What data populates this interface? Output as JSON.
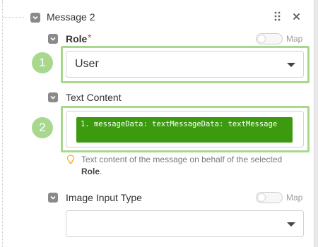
{
  "section": {
    "title": "Message 2"
  },
  "role": {
    "label": "Role",
    "required_mark": "*",
    "map_label": "Map",
    "selected_value": "User",
    "badge": "1"
  },
  "text_content": {
    "label": "Text Content",
    "badge": "2",
    "pill_text": "1. messageData: textMessageData: textMessage",
    "hint_prefix": "Text content of the message on behalf of the selected",
    "hint_bold": "Role",
    "hint_suffix": "."
  },
  "image_input_type": {
    "label": "Image Input Type",
    "map_label": "Map",
    "selected_value": ""
  },
  "colors": {
    "highlight_green": "#a8d88e",
    "pill_green": "#3c9a0e",
    "required_red": "#e03b3b"
  }
}
